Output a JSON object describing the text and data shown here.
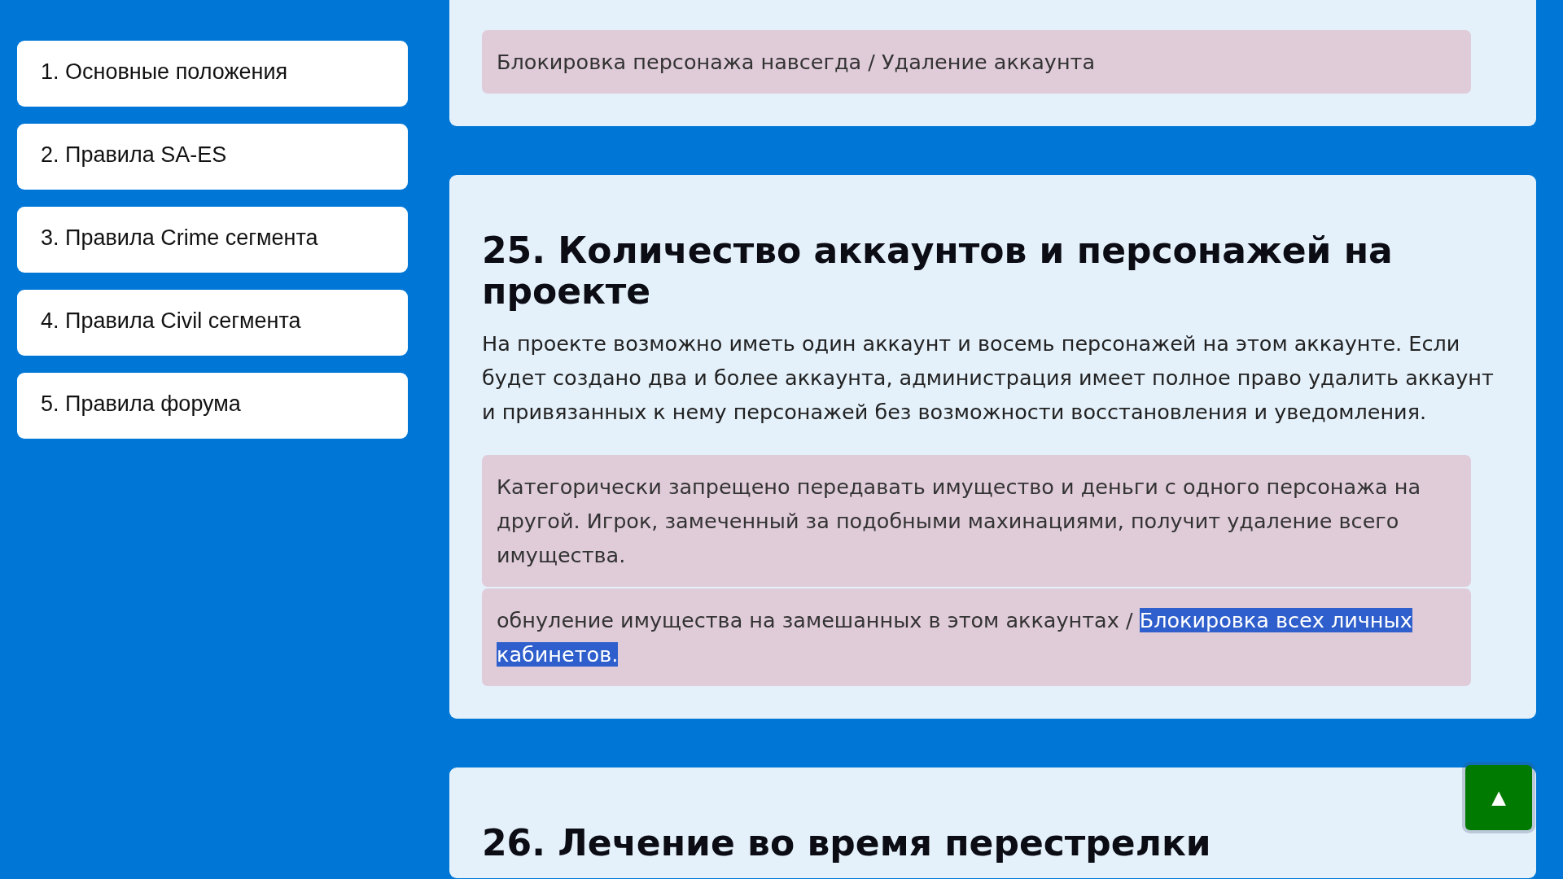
{
  "sidebar": {
    "items": [
      {
        "label": "1. Основные положения"
      },
      {
        "label": "2. Правила SA-ES"
      },
      {
        "label": "3. Правила Crime сегмента"
      },
      {
        "label": "4. Правила Civil сегмента"
      },
      {
        "label": "5. Правила форума"
      }
    ]
  },
  "sections": [
    {
      "notes": [
        {
          "text": "Блокировка персонажа навсегда / Удаление аккаунта"
        }
      ]
    },
    {
      "title": "25. Количество аккаунтов и персонажей на проекте",
      "paragraph": "На проекте возможно иметь один аккаунт и восемь персонажей на этом аккаунте. Если будет создано два и более аккаунта, администрация имеет полное право удалить аккаунт и привязанных к нему персонажей без возможности восстановления и уведомления.",
      "notes": [
        {
          "text": "Категорически запрещено передавать имущество и деньги с одного персонажа на другой. Игрок, замеченный за подобными махинациями, получит удаление всего имущества."
        },
        {
          "text": "обнуление имущества на замешанных в этом аккаунтах / ",
          "highlighted": "Блокировка всех личных кабинетов."
        }
      ]
    },
    {
      "title": "26. Лечение во время перестрелки"
    }
  ],
  "scroll_top_button": {
    "label": "▲"
  }
}
